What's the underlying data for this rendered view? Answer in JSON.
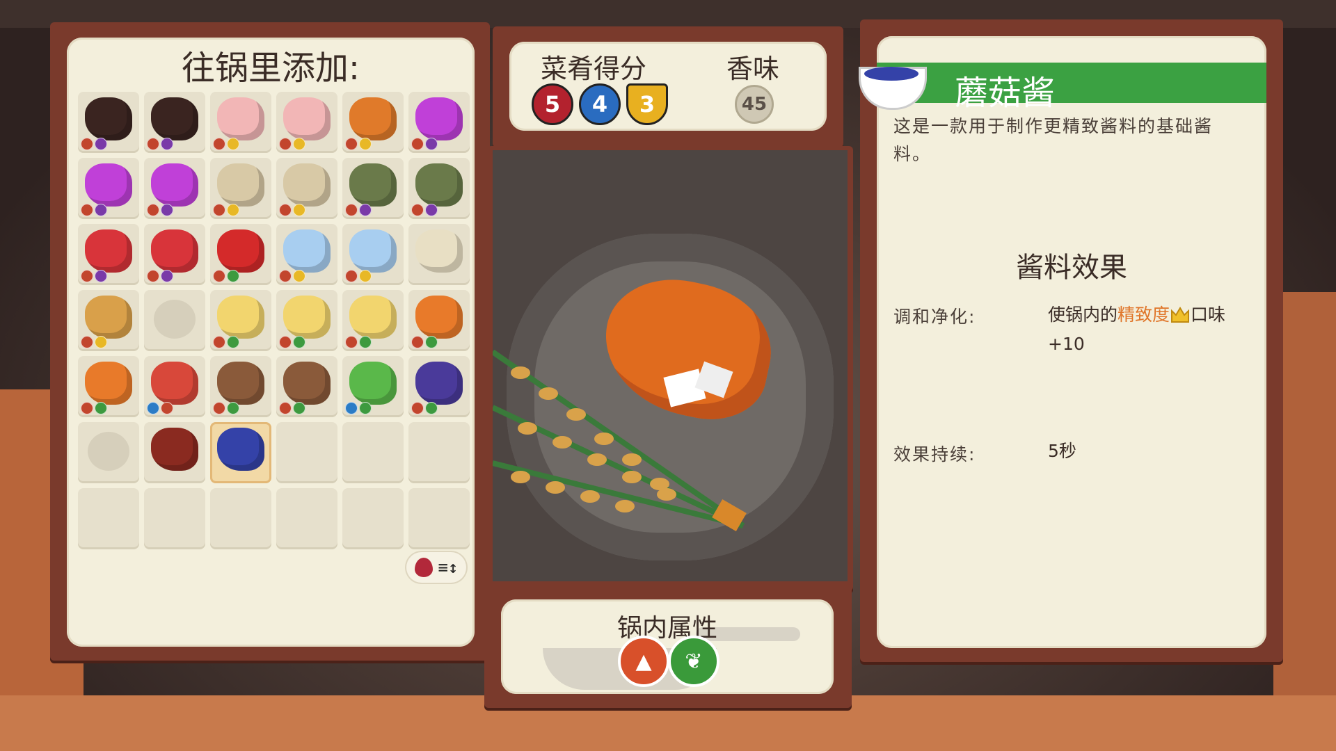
{
  "inventory": {
    "title": "往锅里添加:",
    "items": [
      {
        "icon": "dark-meat-icon",
        "color": "#3a2420",
        "badges": [
          "red",
          "purple"
        ]
      },
      {
        "icon": "dark-meat-icon",
        "color": "#3a2420",
        "badges": [
          "red",
          "purple"
        ]
      },
      {
        "icon": "ham-leg-icon",
        "color": "#f2b6b6",
        "badges": [
          "red",
          "yellow"
        ]
      },
      {
        "icon": "ham-leg-icon",
        "color": "#f2b6b6",
        "badges": [
          "red",
          "yellow"
        ]
      },
      {
        "icon": "drumstick-icon",
        "color": "#e07a2a",
        "badges": [
          "red",
          "yellow"
        ]
      },
      {
        "icon": "star-slime-icon",
        "color": "#c040d8",
        "badges": [
          "red",
          "purple"
        ]
      },
      {
        "icon": "star-slime-icon",
        "color": "#c040d8",
        "badges": [
          "red",
          "purple"
        ]
      },
      {
        "icon": "star-slime-icon",
        "color": "#c040d8",
        "badges": [
          "red",
          "purple"
        ]
      },
      {
        "icon": "spotted-egg-icon",
        "color": "#d8c9a6",
        "badges": [
          "red",
          "yellow"
        ]
      },
      {
        "icon": "spotted-egg-icon",
        "color": "#d8c9a6",
        "badges": [
          "red",
          "yellow"
        ]
      },
      {
        "icon": "witch-goblin-icon",
        "color": "#6a7a4a",
        "badges": [
          "red",
          "purple"
        ]
      },
      {
        "icon": "witch-goblin-icon",
        "color": "#6a7a4a",
        "badges": [
          "red",
          "purple"
        ]
      },
      {
        "icon": "dragon-fruit-icon",
        "color": "#d8343a",
        "badges": [
          "red",
          "purple"
        ]
      },
      {
        "icon": "dragon-fruit-icon",
        "color": "#d8343a",
        "badges": [
          "red",
          "purple"
        ]
      },
      {
        "icon": "apple-icon",
        "color": "#d42a2a",
        "badges": [
          "red",
          "green"
        ]
      },
      {
        "icon": "milk-carton-icon",
        "color": "#a8cef0",
        "badges": [
          "red",
          "yellow"
        ]
      },
      {
        "icon": "milk-carton-icon",
        "color": "#a8cef0",
        "badges": [
          "red",
          "yellow"
        ]
      },
      {
        "icon": "flour-sack-icon",
        "color": "#e8dfc4",
        "badges": []
      },
      {
        "icon": "roast-chicken-icon",
        "color": "#d9a04a",
        "badges": [
          "red",
          "yellow"
        ]
      },
      {
        "icon": "empty-slot-ghost-icon",
        "color": "",
        "badges": []
      },
      {
        "icon": "potato-icon",
        "color": "#f2d56e",
        "badges": [
          "red",
          "green"
        ]
      },
      {
        "icon": "potato-icon",
        "color": "#f2d56e",
        "badges": [
          "red",
          "green"
        ]
      },
      {
        "icon": "potato-icon",
        "color": "#f2d56e",
        "badges": [
          "red",
          "green"
        ]
      },
      {
        "icon": "carrot-icon",
        "color": "#e87a2a",
        "badges": [
          "red",
          "green"
        ]
      },
      {
        "icon": "carrot-icon",
        "color": "#e87a2a",
        "badges": [
          "red",
          "green"
        ]
      },
      {
        "icon": "crab-icon",
        "color": "#d8483a",
        "badges": [
          "blue",
          "red"
        ]
      },
      {
        "icon": "wood-log-icon",
        "color": "#8a5a3a",
        "badges": [
          "red",
          "green"
        ]
      },
      {
        "icon": "wood-log-icon",
        "color": "#8a5a3a",
        "badges": [
          "red",
          "green"
        ]
      },
      {
        "icon": "green-onion-icon",
        "color": "#5ab84a",
        "badges": [
          "blue",
          "green"
        ]
      },
      {
        "icon": "purple-mushroom-icon",
        "color": "#4a3a9a",
        "badges": [
          "red",
          "green"
        ]
      },
      {
        "icon": "empty-slot-ghost-icon",
        "color": "",
        "badges": []
      },
      {
        "icon": "sauce-jar-icon",
        "color": "#8a2a20",
        "badges": []
      },
      {
        "icon": "mushroom-sauce-bowl-icon",
        "color": "#3442a8",
        "badges": [],
        "selected": true
      },
      {
        "icon": "",
        "color": "",
        "badges": []
      },
      {
        "icon": "",
        "color": "",
        "badges": []
      },
      {
        "icon": "",
        "color": "",
        "badges": []
      },
      {
        "icon": "",
        "color": "",
        "badges": []
      },
      {
        "icon": "",
        "color": "",
        "badges": []
      },
      {
        "icon": "",
        "color": "",
        "badges": []
      },
      {
        "icon": "",
        "color": "",
        "badges": []
      },
      {
        "icon": "",
        "color": "",
        "badges": []
      },
      {
        "icon": "",
        "color": "",
        "badges": []
      }
    ],
    "sort_button_label": "≡↕"
  },
  "score": {
    "dish_score_label": "菜肴得分",
    "aroma_label": "香味",
    "values": [
      {
        "value": "5",
        "color": "#b3222e",
        "icon": "flavor-drop-icon"
      },
      {
        "value": "4",
        "color": "#2a6cc0",
        "icon": "texture-circle-icon"
      },
      {
        "value": "3",
        "color": "#e8b020",
        "icon": "refinement-crown-icon"
      }
    ],
    "aroma_value": "45"
  },
  "pot_properties": {
    "title": "锅内属性",
    "icons": [
      {
        "icon": "mountain-icon",
        "color": "#d8502a"
      },
      {
        "icon": "leaf-icon",
        "color": "#3a9a3a"
      }
    ]
  },
  "detail": {
    "title": "蘑菇酱",
    "description": "这是一款用于制作更精致酱料的基础酱料。",
    "effects_title": "酱料效果",
    "rows": [
      {
        "label": "调和净化:",
        "value_prefix": "使锅内的",
        "value_highlight": "精致度",
        "value_suffix": "口味+10"
      },
      {
        "label": "效果持续:",
        "value": "5秒"
      }
    ],
    "banner_color": "#3ba142",
    "highlight_color": "#e0762a"
  }
}
